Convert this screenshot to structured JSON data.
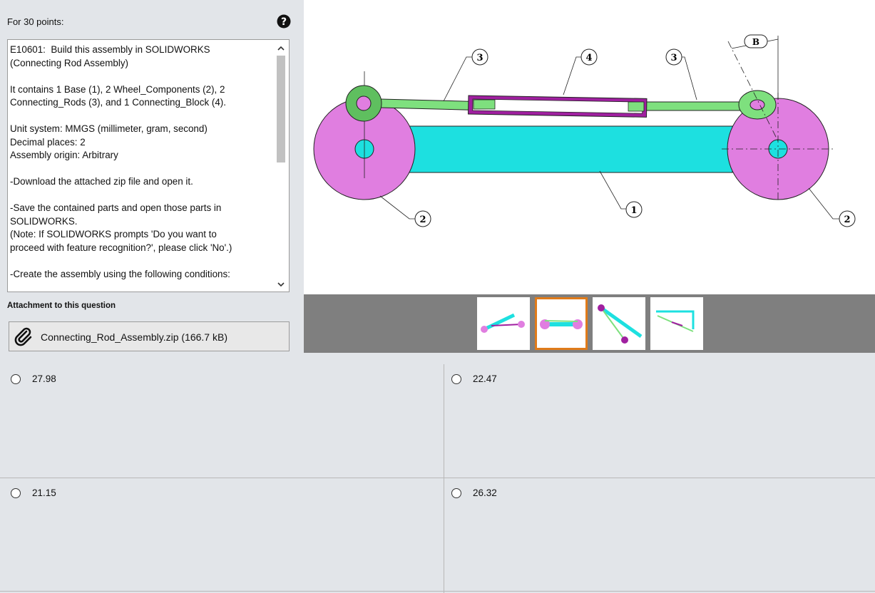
{
  "question": {
    "points_label": "For 30 points:",
    "help_icon": "question-circle-icon",
    "text": "E10601:  Build this assembly in SOLIDWORKS\n(Connecting Rod Assembly)\n\nIt contains 1 Base (1), 2 Wheel_Components (2), 2\nConnecting_Rods (3), and 1 Connecting_Block (4).\n\nUnit system: MMGS (millimeter, gram, second)\nDecimal places: 2\nAssembly origin: Arbitrary\n\n-Download the attached zip file and open it.\n\n-Save the contained parts and open those parts in\nSOLIDWORKS.\n(Note: If SOLIDWORKS prompts 'Do you want to\nproceed with feature recognition?', please click 'No'.)\n\n-Create the assembly using the following conditions:"
  },
  "attachment": {
    "label": "Attachment to this question",
    "file": "Connecting_Rod_Assembly.zip (166.7 kB)",
    "icon": "paperclip-icon"
  },
  "drawing": {
    "callouts": [
      "3",
      "4",
      "3",
      "B",
      "1",
      "2",
      "2"
    ],
    "colors": {
      "base": "#1de0e0",
      "wheel": "#e07ee0",
      "rod": "#7ee07e",
      "hub": "#5fbf5f",
      "block": "#a020a0"
    }
  },
  "thumbnails": {
    "count": 4,
    "selected_index": 1
  },
  "answers": [
    {
      "value": "27.98"
    },
    {
      "value": "22.47"
    },
    {
      "value": "21.15"
    },
    {
      "value": "26.32"
    }
  ]
}
